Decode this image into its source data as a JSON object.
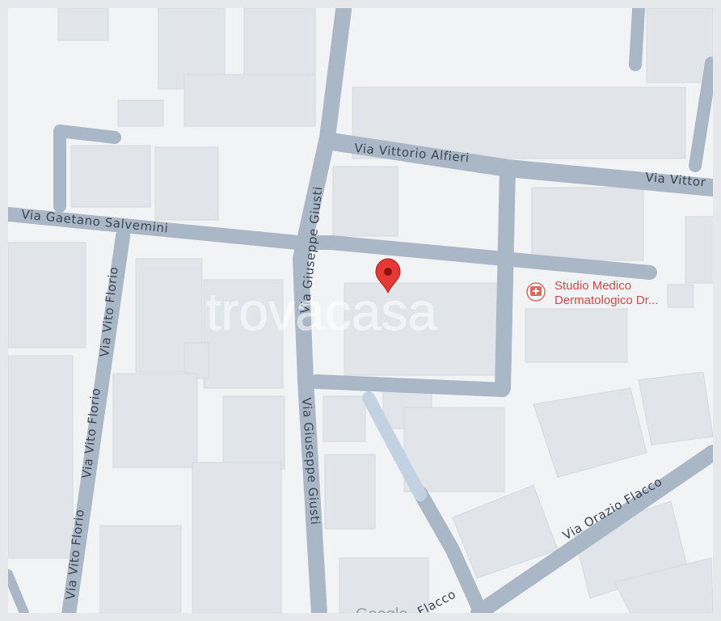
{
  "map": {
    "streets": {
      "via_vittorio_alfieri": "Via Vittorio Alfieri",
      "via_vittor_truncated": "Via Vittor",
      "via_gaetano_salvemini": "Via Gaetano Salvemini",
      "via_giuseppe_giusti": "Via Giuseppe Giusti",
      "via_vito_florio": "Via Vito Florio",
      "via_orazio_flacco": "Via Orazio Flacco",
      "flacco_fragment": "Flacco"
    },
    "poi": {
      "line1": "Studio Medico",
      "line2": "Dermatologico Dr..."
    },
    "watermark": "trovacasa",
    "attribution": "Google",
    "colors": {
      "background": "#f2f3f5",
      "building": "#e1e4e8",
      "road": "#aab7c6",
      "footpath": "#c2d2e2",
      "pin": "#e53935",
      "poi_text": "#d04a4a"
    },
    "icons": {
      "pin": "location-pin-icon",
      "poi": "medical-icon"
    }
  }
}
